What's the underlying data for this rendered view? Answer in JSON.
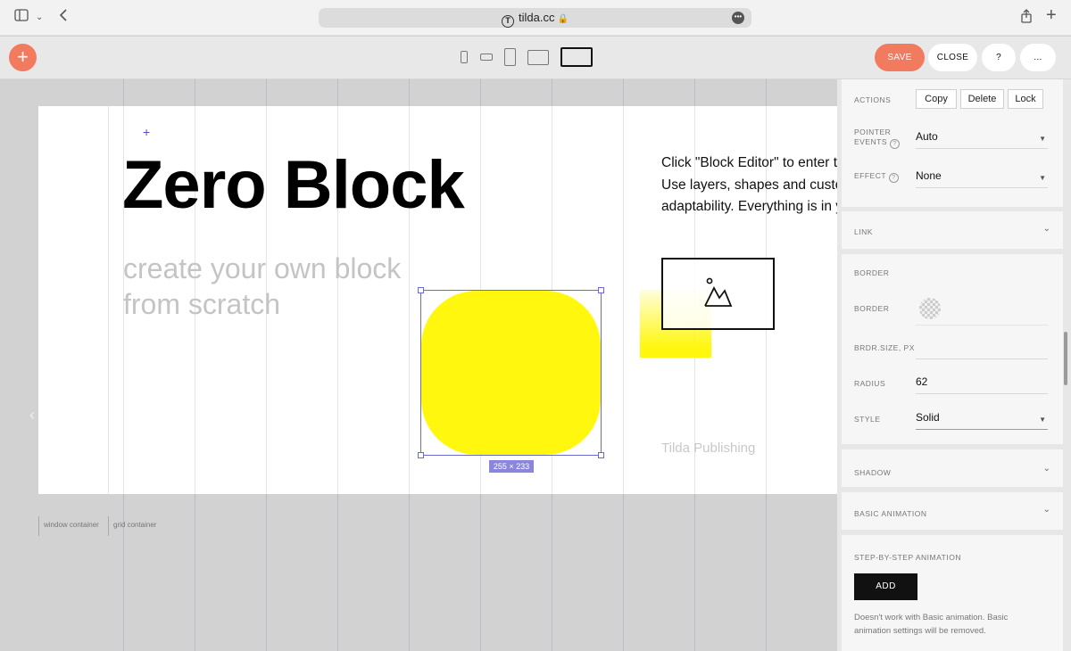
{
  "browser": {
    "url": "tilda.cc",
    "sidebar_icon": "sidebar-icon",
    "more_icon": "•••"
  },
  "toolbar": {
    "add_label": "+",
    "save_label": "SAVE",
    "close_label": "CLOSE",
    "help_label": "?",
    "more_label": "...",
    "accent_color": "#f27a5e"
  },
  "canvas": {
    "title": "Zero Block",
    "subtitle": "create your own block from scratch",
    "paragraph_lines": [
      "Click \"Block Editor\" to enter t",
      "Use layers, shapes and custo",
      "adaptability. Everything is in your hands."
    ],
    "publisher": "Tilda Publishing",
    "size_label": "255 × 233",
    "window_container_label": "window container",
    "grid_container_label": "grid container",
    "shape_color": "#fff70e"
  },
  "panel": {
    "actions": {
      "label": "ACTIONS",
      "copy": "Copy",
      "delete": "Delete",
      "lock": "Lock"
    },
    "pointer_events": {
      "label_line1": "POINTER",
      "label_line2": "EVENTS",
      "value": "Auto"
    },
    "effect": {
      "label": "EFFECT",
      "value": "None"
    },
    "link": {
      "label": "LINK"
    },
    "border": {
      "section_label": "BORDER",
      "border_label": "BORDER",
      "size_label": "BRDR.SIZE, PX",
      "size_value": "",
      "radius_label": "RADIUS",
      "radius_value": "62",
      "style_label": "STYLE",
      "style_value": "Solid"
    },
    "shadow": {
      "label": "SHADOW"
    },
    "basic_animation": {
      "label": "BASIC ANIMATION"
    },
    "step_animation": {
      "label": "STEP-BY-STEP ANIMATION",
      "add_label": "ADD",
      "note": "Doesn't work with Basic animation. Basic animation settings will be removed."
    }
  }
}
